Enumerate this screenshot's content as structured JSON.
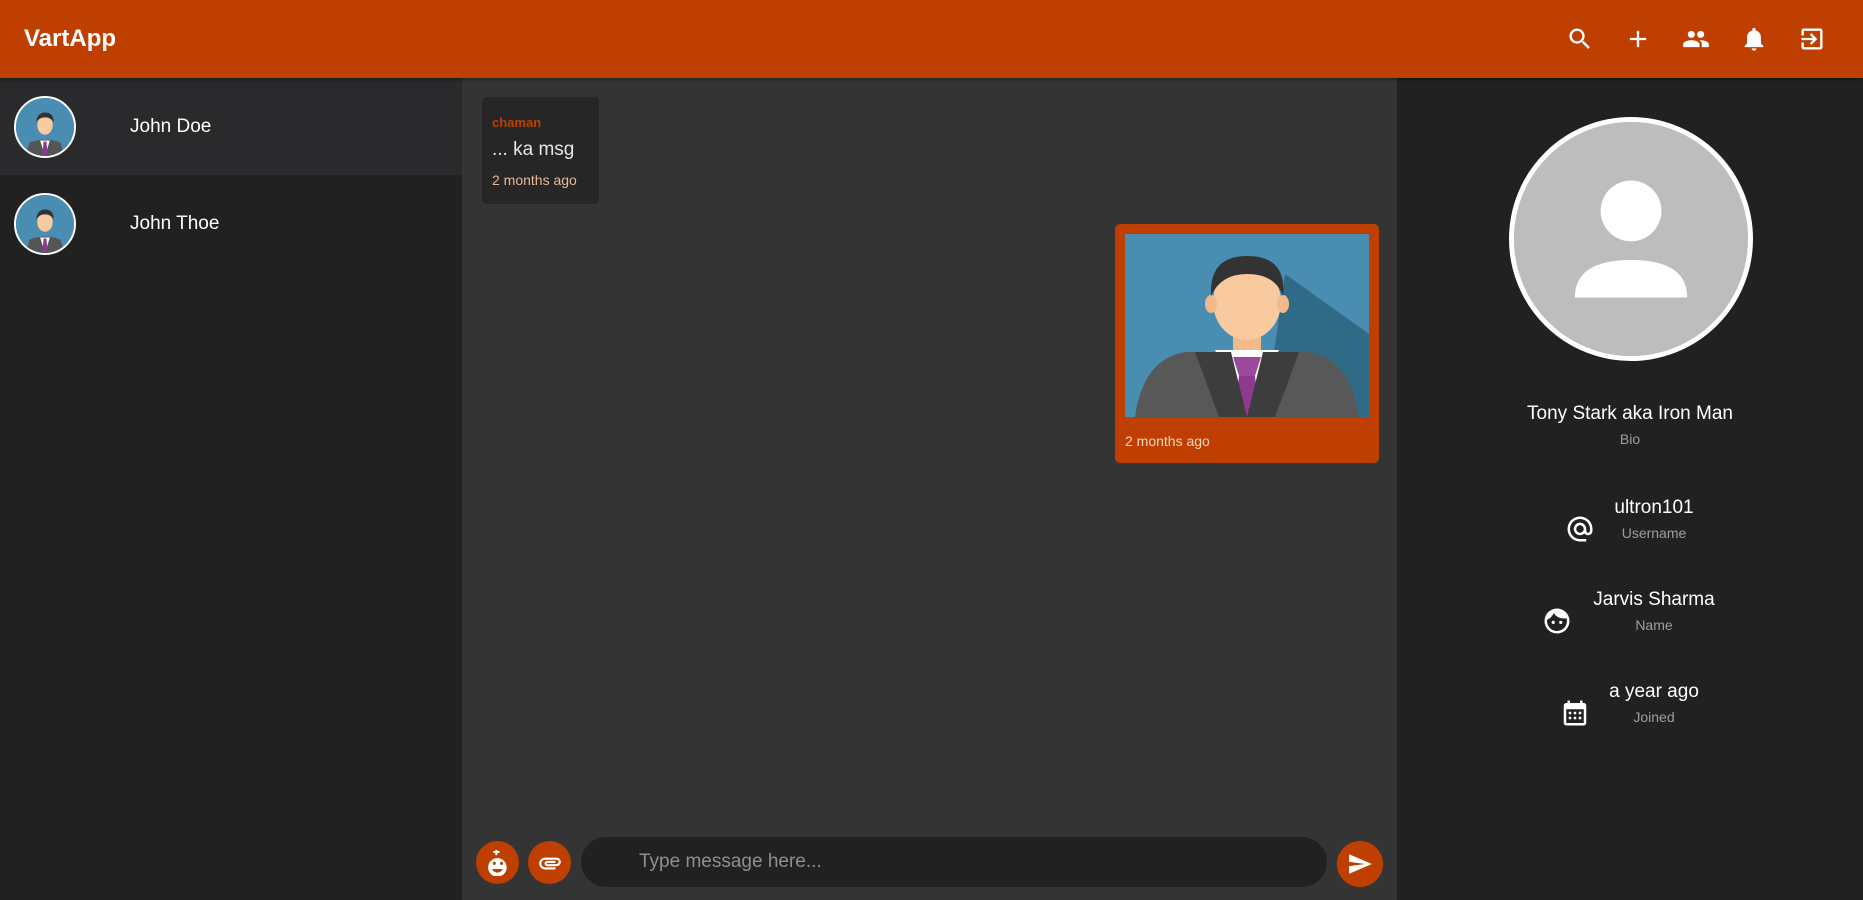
{
  "app": {
    "title": "VartApp",
    "accent": "#bf3f00"
  },
  "toolbar": {
    "icons": [
      "search-icon",
      "add-icon",
      "people-icon",
      "notifications-icon",
      "logout-icon"
    ]
  },
  "contacts": [
    {
      "name": "John Doe",
      "active": true
    },
    {
      "name": "John Thoe",
      "active": false
    }
  ],
  "messages": [
    {
      "direction": "incoming",
      "sender": "chaman",
      "text": "... ka msg",
      "time": "2 months ago"
    },
    {
      "direction": "outgoing",
      "type": "image",
      "time": "2 months ago"
    }
  ],
  "composer": {
    "placeholder": "Type message here..."
  },
  "profile": {
    "bio": "Tony Stark aka Iron Man",
    "bio_label": "Bio",
    "username": "ultron101",
    "username_label": "Username",
    "name": "Jarvis Sharma",
    "name_label": "Name",
    "joined": "a year ago",
    "joined_label": "Joined"
  }
}
